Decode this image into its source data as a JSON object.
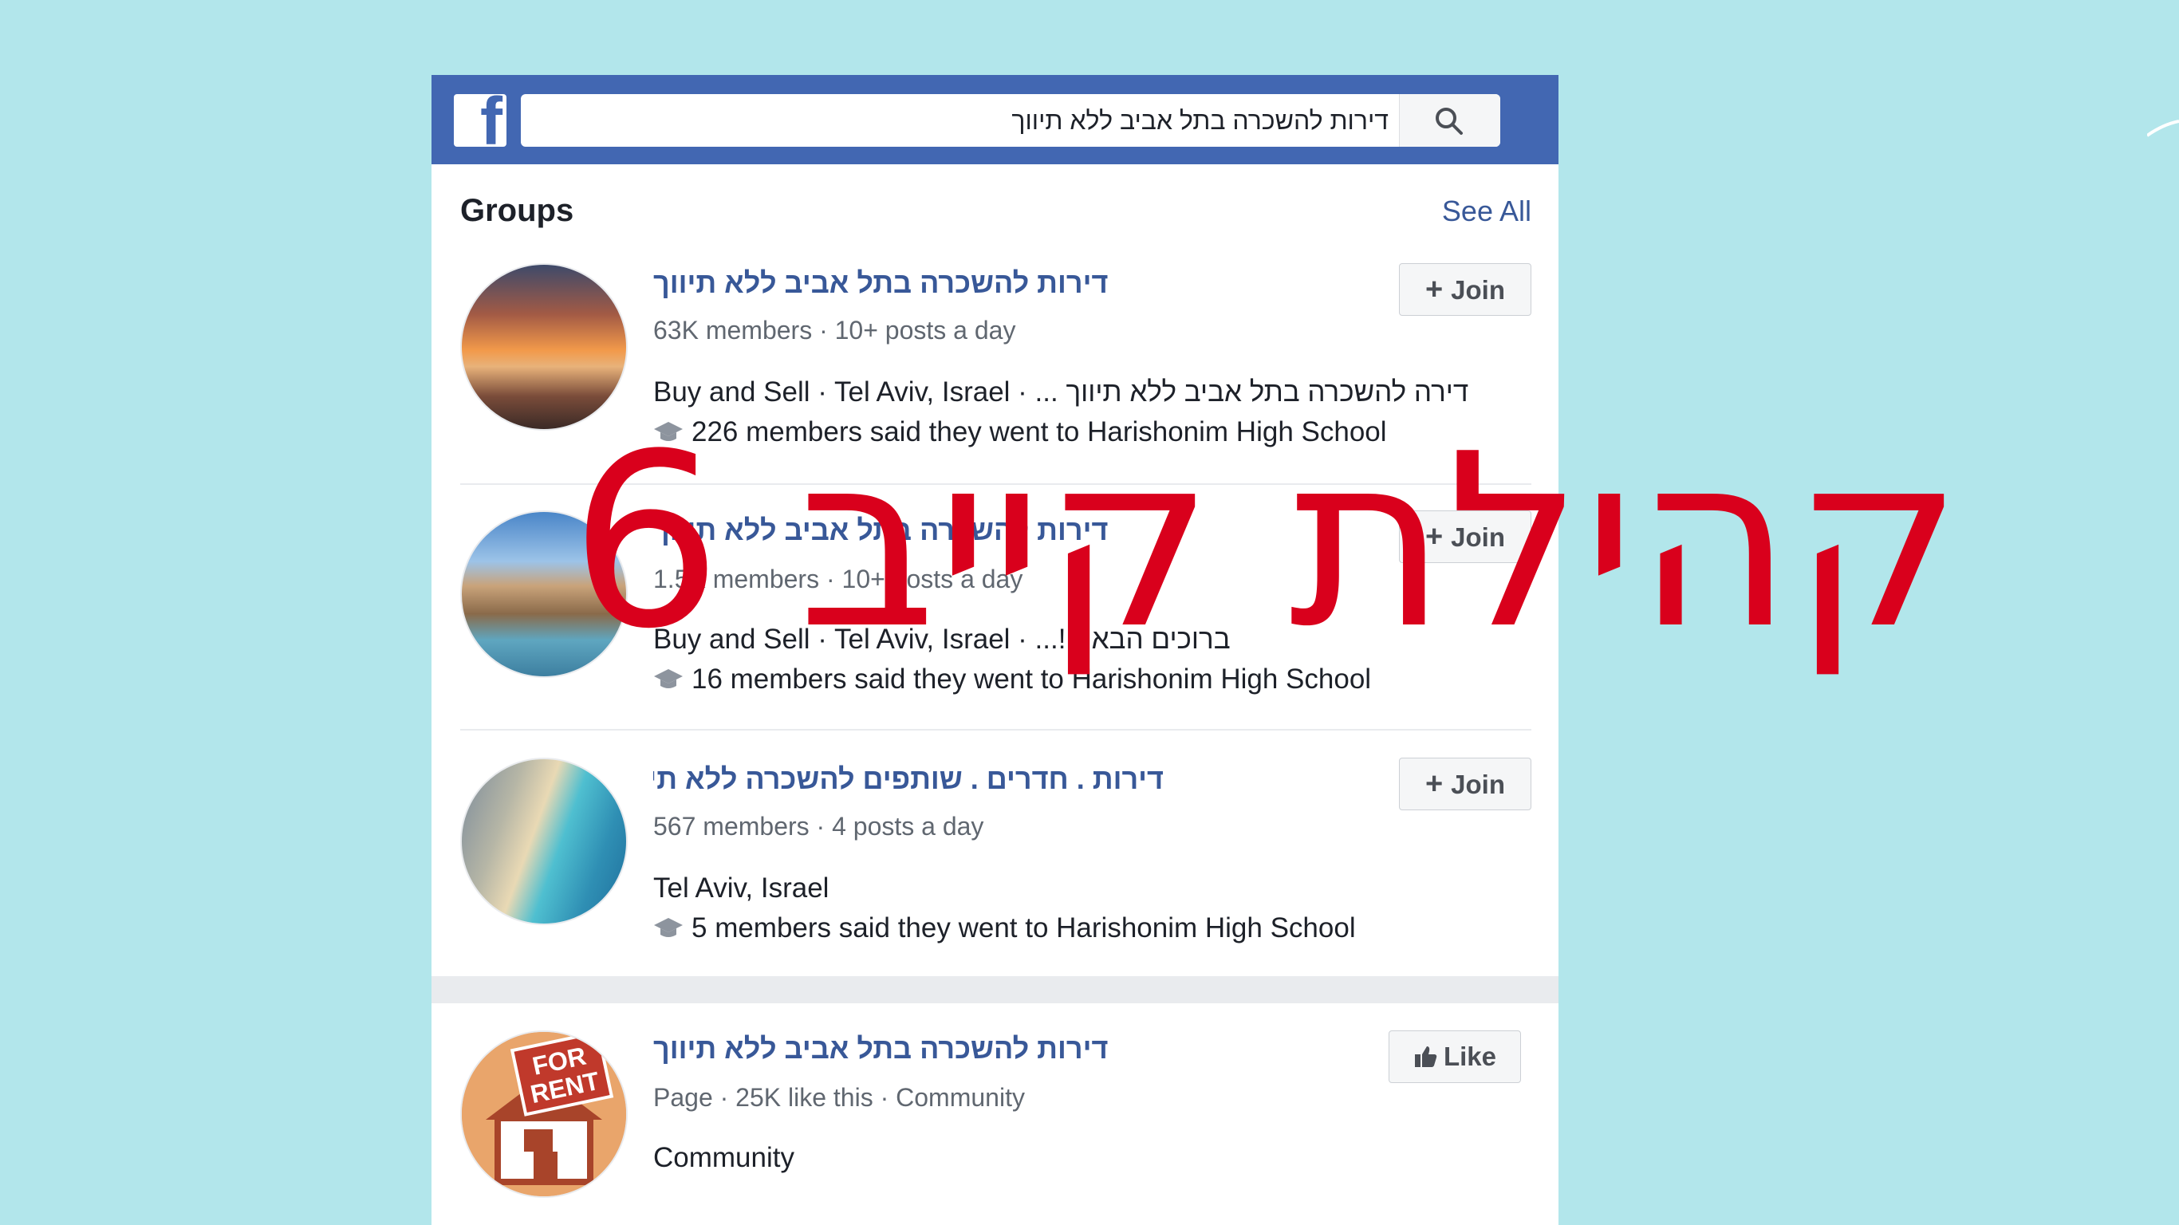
{
  "search": {
    "query": "דירות להשכרה בתל אביב ללא תיווך"
  },
  "groups_section": {
    "title": "Groups",
    "see_all": "See All"
  },
  "groups": [
    {
      "title": "דירות להשכרה בתל אביב ללא תיווך",
      "meta": "63K members · 10+ posts a day",
      "info": "Buy and Sell · Tel Aviv, Israel · ... דירה להשכרה בתל אביב ללא תיווך",
      "school": "226 members said they went to Harishonim High School",
      "button": "Join"
    },
    {
      "title": "דירות להשכרה בתל אביב ללא תיווך",
      "meta": "1.5K members · 10+ posts a day",
      "info": "Buy and Sell · Tel Aviv, Israel · ...!ברוכים הבאים",
      "school": "16 members said they went to Harishonim High School",
      "button": "Join"
    },
    {
      "title": "דירות . חדרים . שותפים להשכרה ללא תיווך בתל אביב",
      "meta": "567 members · 4 posts a day",
      "info": "Tel Aviv, Israel",
      "school": "5 members said they went to Harishonim High School",
      "button": "Join"
    }
  ],
  "page_result": {
    "title": "דירות להשכרה בתל אביב ללא תיווך",
    "meta": "Page · 25K like this · Community",
    "info": "Community",
    "button": "Like",
    "avatar_text_1": "FOR",
    "avatar_text_2": "RENT"
  },
  "overlay_text": "קהילת קייב 6",
  "colors": {
    "background": "#b2e6eb",
    "facebook_blue": "#4267b2",
    "link": "#385898",
    "overlay": "#d9001c"
  }
}
